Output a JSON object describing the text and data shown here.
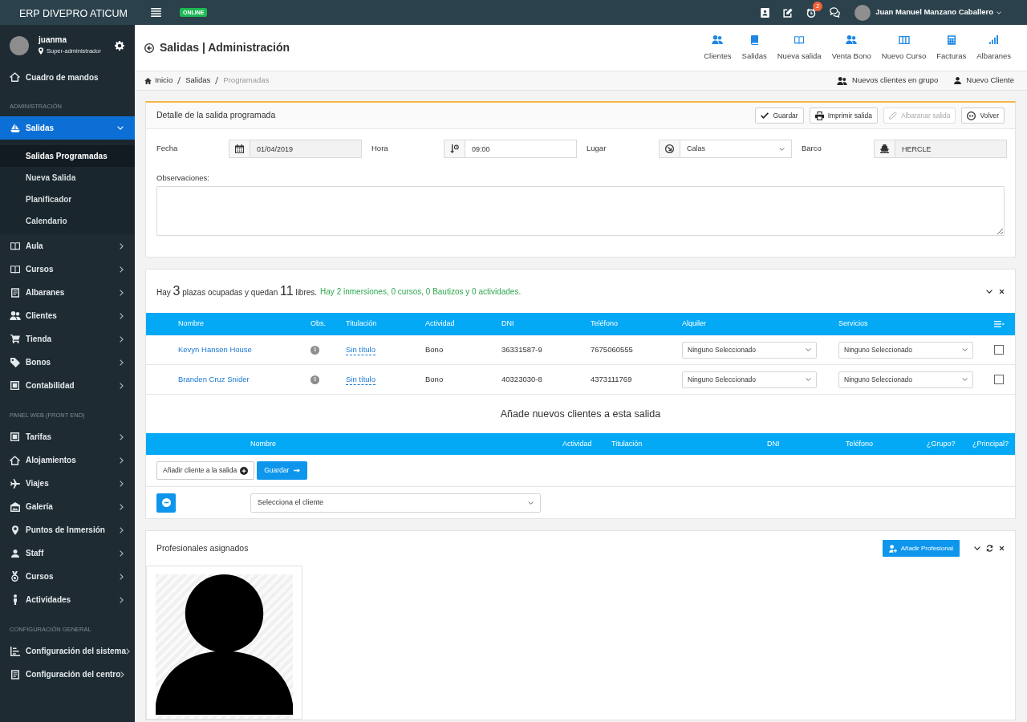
{
  "topbar": {
    "brand": "ERP DIVEPRO ATICUM",
    "status": "ONLINE",
    "alarm_badge": "2",
    "user_name": "Juan Manuel Manzano Caballero"
  },
  "sidebar": {
    "user": {
      "name": "juanma",
      "role": "Super-administrador"
    },
    "dashboard": {
      "label": "Cuadro de mandos",
      "selected": false
    },
    "groups": [
      {
        "heading": "ADMINISTRACIÓN",
        "items": [
          {
            "label": "Salidas",
            "selected": true,
            "expanded": true,
            "children": [
              {
                "label": "Salidas Programadas",
                "selected": true
              },
              {
                "label": "Nueva Salida",
                "selected": false
              },
              {
                "label": "Planificador",
                "selected": false
              },
              {
                "label": "Calendario",
                "selected": false
              }
            ]
          },
          {
            "label": "Aula",
            "selected": false,
            "expanded": false
          },
          {
            "label": "Cursos",
            "selected": false,
            "expanded": false
          },
          {
            "label": "Albaranes",
            "selected": false,
            "expanded": false
          },
          {
            "label": "Clientes",
            "selected": false,
            "expanded": false
          },
          {
            "label": "Tienda",
            "selected": false,
            "expanded": false
          },
          {
            "label": "Bonos",
            "selected": false,
            "expanded": false
          },
          {
            "label": "Contabilidad",
            "selected": false,
            "expanded": false
          }
        ]
      },
      {
        "heading": "PANEL WEB (FRONT END)",
        "items": [
          {
            "label": "Tarifas",
            "selected": false,
            "expanded": false
          },
          {
            "label": "Alojamientos",
            "selected": false,
            "expanded": false
          },
          {
            "label": "Viajes",
            "selected": false,
            "expanded": false
          },
          {
            "label": "Galería",
            "selected": false,
            "expanded": false
          },
          {
            "label": "Puntos de Inmersión",
            "selected": false,
            "expanded": false
          },
          {
            "label": "Staff",
            "selected": false,
            "expanded": false
          },
          {
            "label": "Cursos",
            "selected": false,
            "expanded": false
          },
          {
            "label": "Actividades",
            "selected": false,
            "expanded": false
          }
        ]
      },
      {
        "heading": "CONFIGURACIÓN GENERAL",
        "items": [
          {
            "label": "Configuración del sistema",
            "selected": false,
            "expanded": false
          },
          {
            "label": "Configuración del centro",
            "selected": false,
            "expanded": false
          }
        ]
      }
    ]
  },
  "page": {
    "title": "Salidas | Administración",
    "shortcuts": [
      "Clientes",
      "Salidas",
      "Nueva salida",
      "Venta Bono",
      "Nuevo Curso",
      "Facturas",
      "Albaranes"
    ]
  },
  "breadcrumb": {
    "items": [
      "Inicio",
      "Salidas",
      "Programadas"
    ],
    "actions": [
      "Nuevos clientes en grupo",
      "Nuevo Cliente"
    ]
  },
  "detail": {
    "title": "Detalle de la salida programada",
    "buttons": [
      {
        "label": "Guardar",
        "disabled": false
      },
      {
        "label": "Imprimir salida",
        "disabled": false
      },
      {
        "label": "Albaranar salida",
        "disabled": true
      },
      {
        "label": "Volver",
        "disabled": false
      }
    ],
    "fields": [
      {
        "label": "Fecha",
        "kind": "readonly",
        "value": "01/04/2019"
      },
      {
        "label": "Hora",
        "kind": "input",
        "value": "09:00"
      },
      {
        "label": "Lugar",
        "kind": "select",
        "value": "Calas"
      },
      {
        "label": "Barco",
        "kind": "readonly",
        "value": "HERCLE"
      }
    ],
    "notes_label": "Observaciones:"
  },
  "bookings": {
    "summary": "Hay **3** plazas ocupadas y quedan **11** libres.",
    "activity_summary": "Hay 2 inmersiones, 0 cursos, 0 Bautizos y 0 actividades.",
    "columns": [
      "Nombre",
      "Obs.",
      "Titulación",
      "Actividad",
      "DNI",
      "Teléfono",
      "Alquiler",
      "Servicios"
    ],
    "rows": [
      {
        "nombre": "Kevyn Hansen House",
        "obs": "0",
        "titulacion": "Sin título",
        "actividad": "Bono",
        "dni": "36331587-9",
        "telefono": "7675060555",
        "alquiler": "Ninguno Seleccionado",
        "servicios": "Ninguno Seleccionado",
        "checked": false
      },
      {
        "nombre": "Branden Cruz Snider",
        "obs": "0",
        "titulacion": "Sin título",
        "actividad": "Bono",
        "dni": "40323030-8",
        "telefono": "4373111769",
        "alquiler": "Ninguno Seleccionado",
        "servicios": "Ninguno Seleccionado",
        "checked": false
      }
    ]
  },
  "add_clients": {
    "title": "Añade nuevos clientes a esta salida",
    "columns": [
      "Nombre",
      "Actividad",
      "Titulación",
      "DNI",
      "Teléfono",
      "¿Grupo?",
      "¿Principal?"
    ],
    "buttons": [
      {
        "label": "Añadir cliente a la salida",
        "kind": "outline"
      },
      {
        "label": "Guardar",
        "kind": "primary"
      }
    ],
    "client_select": "Selecciona el cliente"
  },
  "professionals": {
    "title": "Profesionales asignados",
    "button": "Añadir Profesional"
  }
}
